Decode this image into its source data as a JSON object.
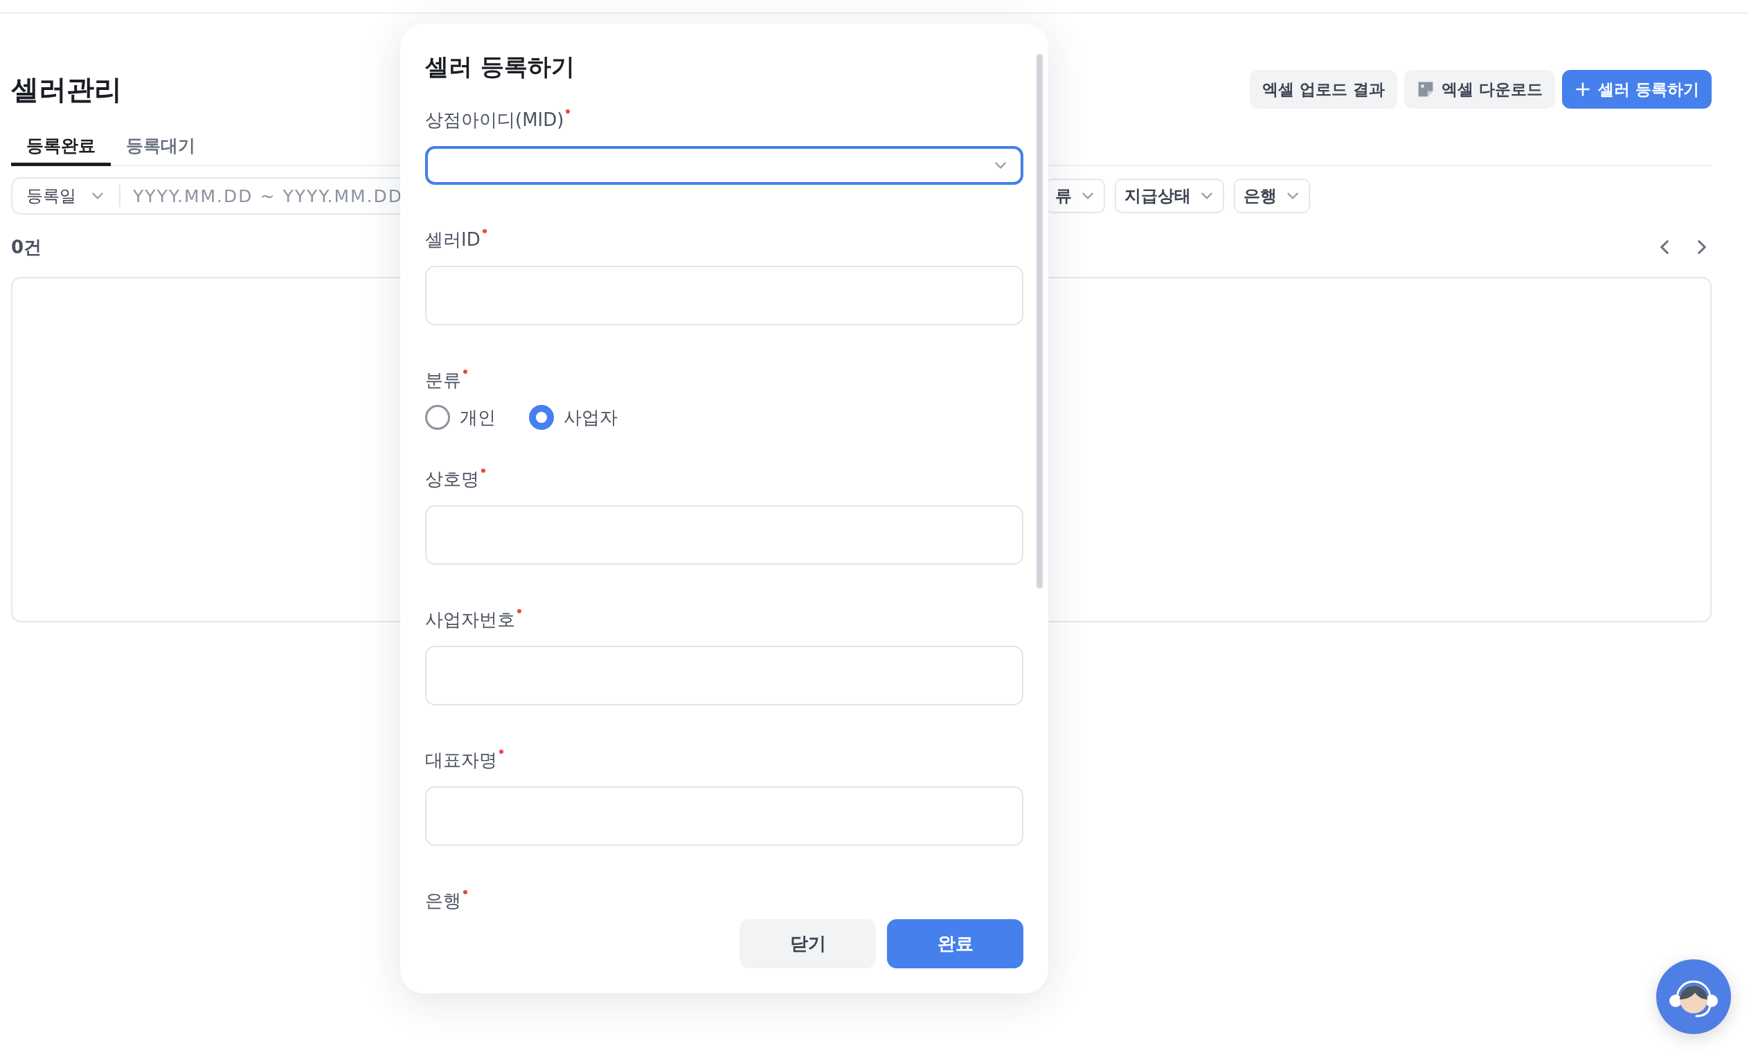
{
  "page": {
    "title": "셀러관리",
    "actions": [
      {
        "label": "엑셀 업로드 결과",
        "kind": "plain"
      },
      {
        "label": "엑셀 다운로드",
        "kind": "excel"
      },
      {
        "label": "셀러 등록하기",
        "kind": "primary"
      }
    ],
    "tabs": [
      {
        "label": "등록완료",
        "selected": true
      },
      {
        "label": "등록대기",
        "selected": false
      }
    ],
    "date_filter": {
      "label": "등록일",
      "start_placeholder": "YYYY.MM.DD",
      "separator": "~",
      "end_placeholder": "YYYY.MM.DD"
    },
    "filters": [
      "류",
      "지급상태",
      "은행"
    ],
    "count": "0건"
  },
  "dialog": {
    "title": "셀러 등록하기",
    "fields": [
      {
        "label": "상점아이디(MID)",
        "required": true,
        "kind": "select",
        "focused": true
      },
      {
        "label": "셀러ID",
        "required": true,
        "kind": "input"
      },
      {
        "label": "분류",
        "required": true,
        "kind": "radio",
        "options": [
          {
            "label": "개인",
            "selected": false
          },
          {
            "label": "사업자",
            "selected": true
          }
        ]
      },
      {
        "label": "상호명",
        "required": true,
        "kind": "input"
      },
      {
        "label": "사업자번호",
        "required": true,
        "kind": "input"
      },
      {
        "label": "대표자명",
        "required": true,
        "kind": "input"
      },
      {
        "label": "은행",
        "required": true,
        "kind": "hidden"
      }
    ],
    "buttons": [
      {
        "label": "닫기",
        "kind": "secondary"
      },
      {
        "label": "완료",
        "kind": "primary"
      }
    ]
  }
}
